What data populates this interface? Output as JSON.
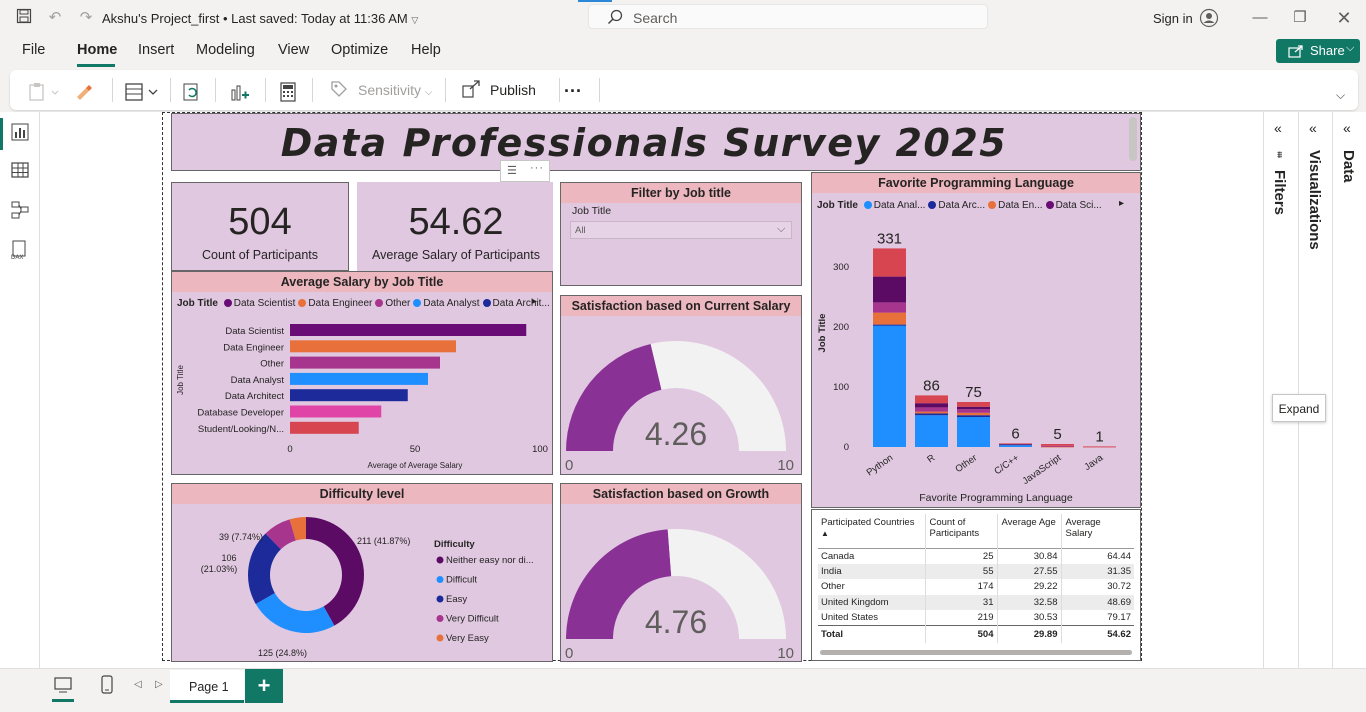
{
  "titlebar": {
    "project": "Akshu's Project_first",
    "saved": "Last saved: Today at 11:36 AM",
    "search_placeholder": "Search",
    "signin": "Sign in"
  },
  "menu": {
    "file": "File",
    "home": "Home",
    "insert": "Insert",
    "modeling": "Modeling",
    "view": "View",
    "optimize": "Optimize",
    "help": "Help",
    "share": "Share"
  },
  "ribbon": {
    "sensitivity": "Sensitivity",
    "publish": "Publish",
    "more": "..."
  },
  "report": {
    "title": "Data Professionals Survey 2025",
    "kpi_count": {
      "value": "504",
      "label": "Count of Participants"
    },
    "kpi_salary": {
      "value": "54.62",
      "label": "Average Salary of Participants"
    },
    "filter": {
      "title": "Filter by Job title",
      "field_label": "Job Title",
      "value": "All"
    },
    "sat_salary": {
      "title": "Satisfaction based on Current Salary",
      "value": "4.26",
      "min": "0",
      "max": "10",
      "fraction": 0.426
    },
    "sat_growth": {
      "title": "Satisfaction based on Growth",
      "value": "4.76",
      "min": "0",
      "max": "10",
      "fraction": 0.476
    },
    "difficulty": {
      "title": "Difficulty level",
      "legend_title": "Difficulty",
      "labels": [
        "211 (41.87%)",
        "125 (24.8%)",
        "106 (21.03%)",
        "39 (7.74%)"
      ],
      "label_106_a": "106",
      "label_106_b": "(21.03%)",
      "legend": [
        "Neither easy nor di...",
        "Difficult",
        "Easy",
        "Very Difficult",
        "Very Easy"
      ]
    },
    "table": {
      "headers": [
        "Participated Countries",
        "Count of Participants",
        "Average Age",
        "Average Salary"
      ],
      "header_count_a": "Count of",
      "header_count_b": "Participants",
      "rows": [
        [
          "Canada",
          "25",
          "30.84",
          "64.44"
        ],
        [
          "India",
          "55",
          "27.55",
          "31.35"
        ],
        [
          "Other",
          "174",
          "29.22",
          "30.72"
        ],
        [
          "United Kingdom",
          "31",
          "32.58",
          "48.69"
        ],
        [
          "United States",
          "219",
          "30.53",
          "79.17"
        ]
      ],
      "total": [
        "Total",
        "504",
        "29.89",
        "54.62"
      ]
    }
  },
  "panes": {
    "filters": "Filters",
    "visualizations": "Visualizations",
    "data": "Data"
  },
  "tooltip": "Expand",
  "bottom": {
    "page1": "Page 1",
    "add": "+"
  },
  "colors": {
    "data_scientist": "#6a0c75",
    "data_engineer": "#e8703a",
    "other": "#a7358e",
    "data_analyst": "#1f8fff",
    "data_architect": "#1c2a9a",
    "db_developer": "#e044a7",
    "student": "#d64550",
    "gauge_fill": "#8a3196",
    "gauge_bg": "#f3f2f2",
    "header_pink": "#ecb7bf",
    "card_bg": "#e0c8e0"
  },
  "chart_data": [
    {
      "type": "bar",
      "orientation": "horizontal",
      "title": "Average Salary by Job Title",
      "legend_title": "Job Title",
      "legend": [
        "Data Scientist",
        "Data Engineer",
        "Other",
        "Data Analyst",
        "Data Archit..."
      ],
      "categories": [
        "Data Scientist",
        "Data Engineer",
        "Other",
        "Data Analyst",
        "Data Architect",
        "Database Developer",
        "Student/Looking/N..."
      ],
      "values": [
        94.5,
        66.4,
        60,
        55.2,
        47.1,
        36.5,
        27.5
      ],
      "colors": [
        "#6a0c75",
        "#e8703a",
        "#a7358e",
        "#1f8fff",
        "#1c2a9a",
        "#e044a7",
        "#d64550"
      ],
      "xlabel": "Average of Average Salary",
      "ylabel": "Job Title",
      "xlim": [
        0,
        100
      ],
      "xticks": [
        "0",
        "50",
        "100"
      ]
    },
    {
      "type": "pie",
      "title": "Difficulty level",
      "categories": [
        "Neither easy nor difficult",
        "Difficult",
        "Easy",
        "Very Difficult",
        "Very Easy"
      ],
      "values": [
        211,
        125,
        106,
        39,
        23
      ],
      "colors": [
        "#5b0b63",
        "#1f8fff",
        "#1c2a9a",
        "#a7358e",
        "#e8703a"
      ]
    },
    {
      "type": "bar",
      "stacked": true,
      "title": "Favorite Programming Language",
      "legend_title": "Job Title",
      "legend": [
        "Data Anal...",
        "Data Arc...",
        "Data En...",
        "Data Sci..."
      ],
      "legend_colors": [
        "#1f8fff",
        "#1c2a9a",
        "#e8703a",
        "#6a0c75"
      ],
      "xlabel": "Favorite Programming Language",
      "ylabel": "Job Title",
      "categories": [
        "Python",
        "R",
        "Other",
        "C/C++",
        "JavaScript",
        "Java"
      ],
      "totals": [
        "331",
        "86",
        "75",
        "6",
        "5",
        "1"
      ],
      "ylim": [
        0,
        340
      ],
      "yticks": [
        "0",
        "100",
        "200",
        "300"
      ],
      "series": [
        {
          "name": "Data Analyst",
          "color": "#1f8fff",
          "values": [
            203,
            53,
            50,
            3,
            0,
            0
          ]
        },
        {
          "name": "Data Architect",
          "color": "#1c2a9a",
          "values": [
            1,
            3,
            3,
            2,
            0,
            0
          ]
        },
        {
          "name": "Data Engineer",
          "color": "#e8703a",
          "values": [
            20,
            3,
            4,
            0,
            1,
            0
          ]
        },
        {
          "name": "Other",
          "color": "#a7358e",
          "values": [
            17,
            7,
            6,
            0,
            1,
            0
          ]
        },
        {
          "name": "Data Scientist",
          "color": "#5b0b63",
          "values": [
            43,
            7,
            4,
            0,
            0,
            0
          ]
        },
        {
          "name": "Student/Looking",
          "color": "#d64550",
          "values": [
            47,
            13,
            8,
            1,
            3,
            1
          ]
        }
      ]
    }
  ]
}
